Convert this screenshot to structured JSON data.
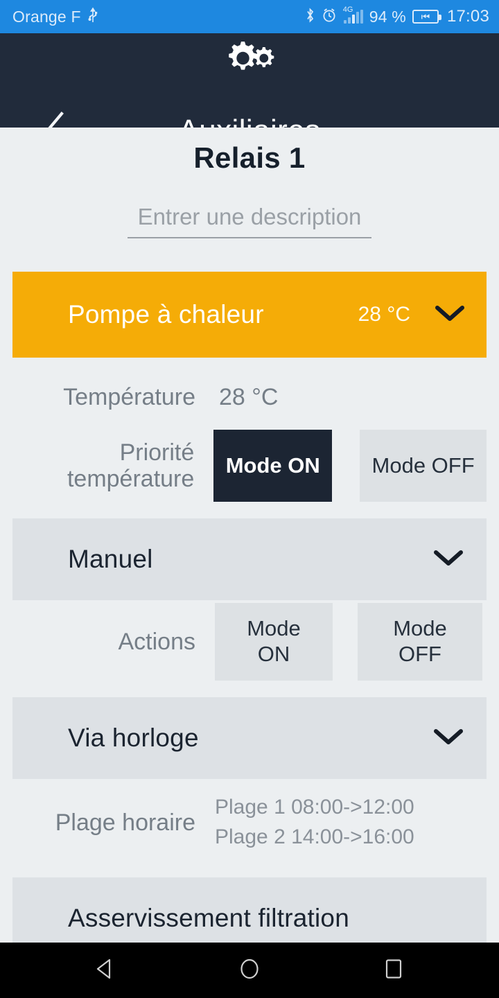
{
  "statusbar": {
    "carrier": "Orange F",
    "usb_icon": "usb-icon",
    "bluetooth_icon": "bluetooth-icon",
    "alarm_icon": "alarm-clock-icon",
    "network_type": "4G",
    "battery_percent": "94 %",
    "battery_icon": "battery-charging-icon",
    "time": "17:03"
  },
  "appbar": {
    "logo_icon": "gears-icon",
    "back_icon": "chevron-left-icon",
    "title": "Auxiliaires"
  },
  "page": {
    "title": "Relais 1",
    "description_value": "",
    "description_placeholder": "Entrer une description"
  },
  "accent": {
    "label": "Pompe à chaleur",
    "value": "28 °C",
    "chevron_icon": "chevron-down-icon",
    "color": "#F5AC07"
  },
  "temperature": {
    "label": "Température",
    "value": "28 °C"
  },
  "priority": {
    "label_line1": "Priorité",
    "label_line2": "température",
    "on_label": "Mode ON",
    "off_label": "Mode OFF",
    "selected": "Mode ON",
    "selected_color": "#1C2533",
    "idle_color": "#DDE1E4"
  },
  "manual_section": {
    "title": "Manuel",
    "chevron_icon": "chevron-down-icon"
  },
  "actions": {
    "label": "Actions",
    "on_line1": "Mode",
    "on_line2": "ON",
    "off_line1": "Mode",
    "off_line2": "OFF"
  },
  "clock_section": {
    "title": "Via horloge",
    "chevron_icon": "chevron-down-icon"
  },
  "schedule": {
    "label": "Plage horaire",
    "range1": "Plage 1 08:00->12:00",
    "range2": "Plage 2 14:00->16:00"
  },
  "filtration_section": {
    "title": "Asservissement filtration"
  },
  "navbar": {
    "back_icon": "triangle-back-icon",
    "home_icon": "circle-home-icon",
    "recents_icon": "square-recents-icon"
  }
}
